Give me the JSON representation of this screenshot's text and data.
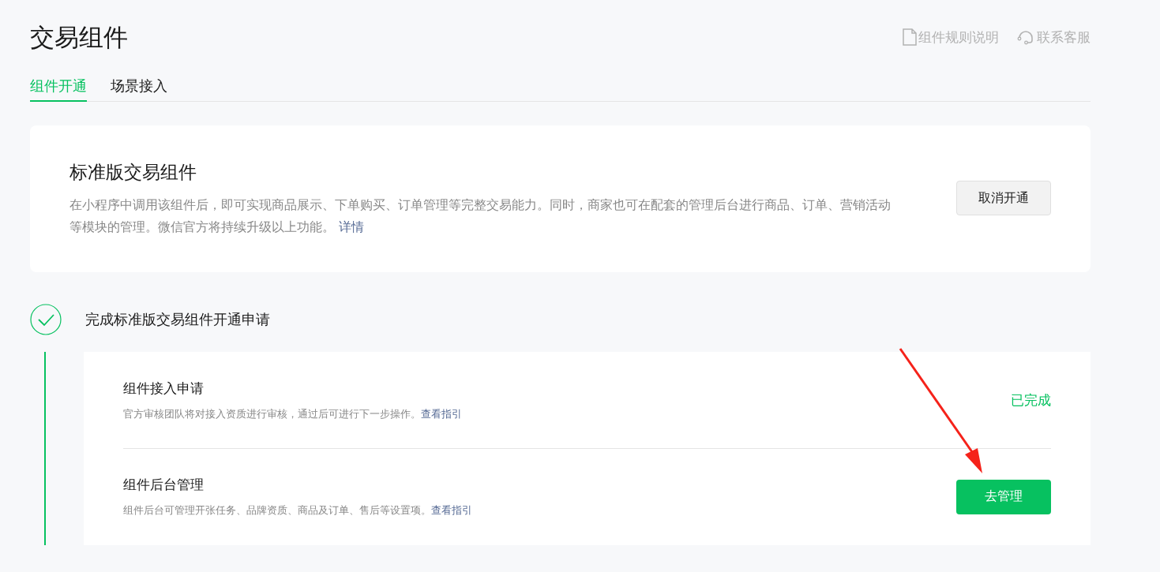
{
  "page_title": "交易组件",
  "header_links": [
    {
      "kind": "document",
      "label": "组件规则说明"
    },
    {
      "kind": "headset",
      "label": "联系客服"
    }
  ],
  "tabs": [
    {
      "label": "组件开通",
      "selected": true
    },
    {
      "label": "场景接入",
      "selected": false
    }
  ],
  "intro_card": {
    "title": "标准版交易组件",
    "description": "在小程序中调用该组件后，即可实现商品展示、下单购买、订单管理等完整交易能力。同时，商家也可在配套的管理后台进行商品、订单、营销活动等模块的管理。微信官方将持续升级以上功能。",
    "link": "详情",
    "button": "取消开通"
  },
  "step": {
    "title": "完成标准版交易组件开通申请",
    "completed": true,
    "items": [
      {
        "title": "组件接入申请",
        "description": "官方审核团队将对接入资质进行审核，通过后可进行下一步操作。",
        "link": "查看指引",
        "kind": "status",
        "action": "已完成"
      },
      {
        "title": "组件后台管理",
        "description": "组件后台可管理开张任务、品牌资质、商品及订单、售后等设置项。",
        "link": "查看指引",
        "kind": "button",
        "action": "去管理"
      }
    ]
  }
}
